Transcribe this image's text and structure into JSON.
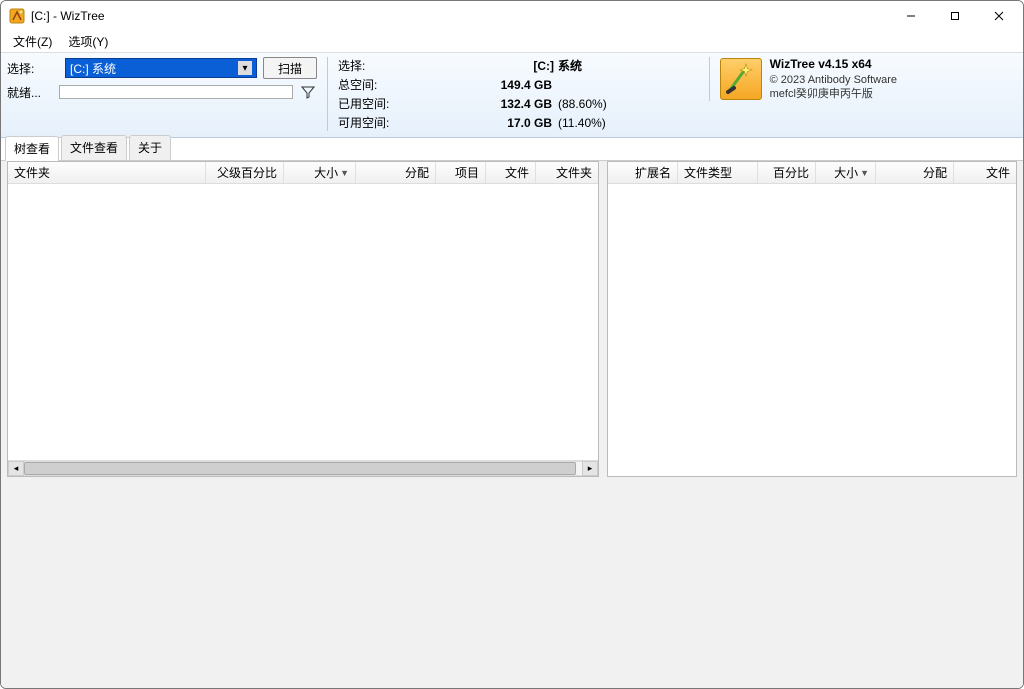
{
  "window": {
    "title": "[C:]  - WizTree"
  },
  "menu": {
    "file": "文件(Z)",
    "options": "选项(Y)"
  },
  "toolbar": {
    "select_label": "选择:",
    "drive_text": "[C:] 系统",
    "scan_label": "扫描",
    "ready_label": "就绪...",
    "info": {
      "select_label": "选择:",
      "drive_short": "[C:]",
      "drive_name": "系统",
      "total_label": "总空间:",
      "total_value": "149.4 GB",
      "used_label": "已用空间:",
      "used_value": "132.4 GB",
      "used_pct": "(88.60%)",
      "free_label": "可用空间:",
      "free_value": "17.0 GB",
      "free_pct": "(11.40%)"
    },
    "brand": {
      "name": "WizTree v4.15 x64",
      "copyright": "© 2023 Antibody Software",
      "edition": "mefcl癸卯庚申丙午版"
    }
  },
  "tabs": {
    "tree": "树查看",
    "file": "文件查看",
    "about": "关于"
  },
  "tree_headers": {
    "folder": "文件夹",
    "parent_pct": "父级百分比",
    "size": "大小",
    "alloc": "分配",
    "items": "项目",
    "files": "文件",
    "folders": "文件夹"
  },
  "ext_headers": {
    "ext": "扩展名",
    "type": "文件类型",
    "pct": "百分比",
    "size": "大小",
    "alloc": "分配",
    "files": "文件"
  }
}
